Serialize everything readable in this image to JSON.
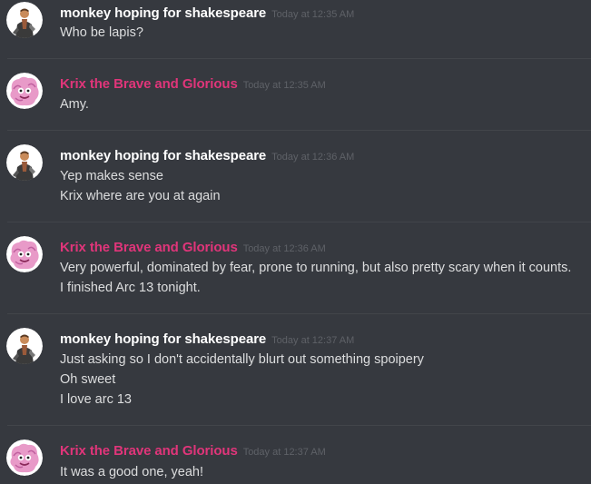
{
  "users": {
    "monkey": {
      "name": "monkey hoping for shakespeare",
      "color": "#ffffff",
      "avatar": "monkey-avatar-icon"
    },
    "krix": {
      "name": "Krix the Brave and Glorious",
      "color": "#e0357a",
      "avatar": "pink-creature-avatar-icon"
    }
  },
  "messages": [
    {
      "author": "monkey hoping for shakespeare",
      "timestamp": "Today at 12:35 AM",
      "lines": [
        "Who be lapis?"
      ]
    },
    {
      "author": "Krix the Brave and Glorious",
      "timestamp": "Today at 12:35 AM",
      "lines": [
        "Amy."
      ]
    },
    {
      "author": "monkey hoping for shakespeare",
      "timestamp": "Today at 12:36 AM",
      "lines": [
        "Yep makes sense",
        "Krix where are you at again"
      ]
    },
    {
      "author": "Krix the Brave and Glorious",
      "timestamp": "Today at 12:36 AM",
      "lines": [
        "Very powerful, dominated by fear, prone to running, but also pretty scary when it counts.",
        "I finished Arc 13 tonight."
      ]
    },
    {
      "author": "monkey hoping for shakespeare",
      "timestamp": "Today at 12:37 AM",
      "lines": [
        "Just asking so I don't accidentally blurt out something spoipery",
        "Oh sweet",
        "I love arc 13"
      ]
    },
    {
      "author": "Krix the Brave and Glorious",
      "timestamp": "Today at 12:37 AM",
      "lines": [
        "It was a good one, yeah!"
      ]
    }
  ],
  "colors": {
    "background": "#36393f",
    "message_text": "#dcddde",
    "timestamp": "#5e6167",
    "divider": "#42454a"
  }
}
